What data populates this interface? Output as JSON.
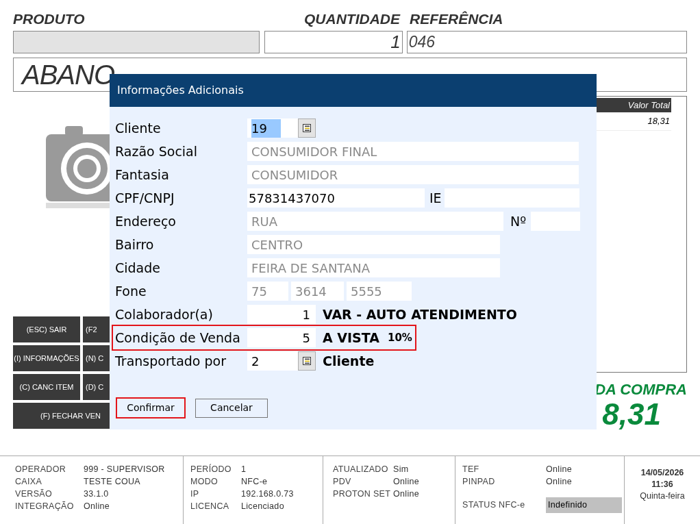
{
  "product_label": "PRODUTO",
  "quantity_label": "QUANTIDADE",
  "reference_label": "REFERÊNCIA",
  "quantity": "1",
  "reference": "046",
  "product_name": "ABANO",
  "actions": [
    {
      "label": "(ESC) SAIR",
      "wide": false
    },
    {
      "label": "(F2",
      "wide": false
    },
    {
      "label": "(I) INFORMAÇÕES",
      "wide": false
    },
    {
      "label": "(N) C",
      "wide": false
    },
    {
      "label": "(C) CANC ITEM",
      "wide": false
    },
    {
      "label": "(D) C",
      "wide": false
    },
    {
      "label": "(F) FECHAR VEN",
      "wide": true
    }
  ],
  "items_table": {
    "columns": [
      "Valor Total"
    ],
    "rows": [
      [
        "18,31"
      ]
    ]
  },
  "total": {
    "label": "DA COMPRA",
    "value": "8,31"
  },
  "dialog": {
    "title": "Informações Adicionais",
    "rows": [
      {
        "kind": "lookup",
        "label": "Cliente",
        "flagged": false,
        "fields": [
          {
            "value": "19",
            "disabled": false,
            "selected": true
          }
        ]
      },
      {
        "kind": "wide",
        "label": "Razão Social",
        "flagged": false,
        "fields": [
          {
            "value": "CONSUMIDOR FINAL",
            "disabled": true,
            "selected": false
          }
        ]
      },
      {
        "kind": "wide",
        "label": "Fantasia",
        "flagged": false,
        "fields": [
          {
            "value": "CONSUMIDOR",
            "disabled": true,
            "selected": false
          }
        ]
      },
      {
        "kind": "document",
        "label": "CPF/CNPJ",
        "flagged": false,
        "second_label": "IE",
        "fields": [
          {
            "value": "57831437070",
            "disabled": false,
            "selected": false
          }
        ]
      },
      {
        "kind": "address",
        "label": "Endereço",
        "flagged": false,
        "second_label": "Nº",
        "fields": [
          {
            "value": "RUA",
            "disabled": true,
            "selected": false
          }
        ]
      },
      {
        "kind": "short",
        "label": "Bairro",
        "flagged": false,
        "fields": [
          {
            "value": "CENTRO",
            "disabled": true,
            "selected": false
          }
        ]
      },
      {
        "kind": "short",
        "label": "Cidade",
        "flagged": false,
        "fields": [
          {
            "value": "FEIRA DE SANTANA",
            "disabled": true,
            "selected": false
          }
        ]
      },
      {
        "kind": "phone",
        "label": "Fone",
        "flagged": false,
        "fields": [
          {
            "value": "75",
            "disabled": true,
            "selected": false
          },
          {
            "value": "3614",
            "disabled": true,
            "selected": false
          },
          {
            "value": "5555",
            "disabled": true,
            "selected": false
          }
        ]
      },
      {
        "kind": "code",
        "label": "Colaborador(a)",
        "flagged": false,
        "description": "VAR - AUTO ATENDIMENTO",
        "fields": [
          {
            "value": "1",
            "disabled": false,
            "selected": false
          }
        ]
      },
      {
        "kind": "code",
        "label": "Condição de Venda",
        "flagged": true,
        "description": "A VISTA",
        "note": "10%",
        "fields": [
          {
            "value": "5",
            "disabled": false,
            "selected": false
          }
        ]
      },
      {
        "kind": "lookup",
        "label": "Transportado por",
        "flagged": false,
        "description": "Cliente",
        "fields": [
          {
            "value": "2",
            "disabled": false,
            "selected": false
          }
        ]
      }
    ],
    "buttons": [
      {
        "label": "Confirmar",
        "focused": true
      },
      {
        "label": "Cancelar",
        "focused": false
      }
    ]
  },
  "status_bar": [
    {
      "items": [
        {
          "label": "OPERADOR",
          "value": "999 - SUPERVISOR"
        },
        {
          "label": "CAIXA",
          "value": "TESTE COUA"
        },
        {
          "label": "VERSÃO",
          "value": "33.1.0"
        },
        {
          "label": "INTEGRAÇÃO",
          "value": "Online"
        }
      ]
    },
    {
      "items": [
        {
          "label": "PERÍODO",
          "value": "1"
        },
        {
          "label": "MODO",
          "value": "NFC-e"
        },
        {
          "label": "IP",
          "value": "192.168.0.73"
        },
        {
          "label": "LICENCA",
          "value": "Licenciado"
        }
      ]
    },
    {
      "items": [
        {
          "label": "ATUALIZADO",
          "value": "Sim"
        },
        {
          "label": "PDV",
          "value": "Online"
        },
        {
          "label": "PROTON SET",
          "value": "Online"
        }
      ]
    },
    {
      "items": [
        {
          "label": "TEF",
          "value": "Online"
        },
        {
          "label": "PINPAD",
          "value": "Online"
        },
        {
          "label": "STATUS NFC-e",
          "value": "Indefinido",
          "kind": "badge"
        }
      ]
    }
  ],
  "clock": {
    "date": "14/05/2026",
    "time": "11:36",
    "weekday": "Quinta-feira"
  }
}
